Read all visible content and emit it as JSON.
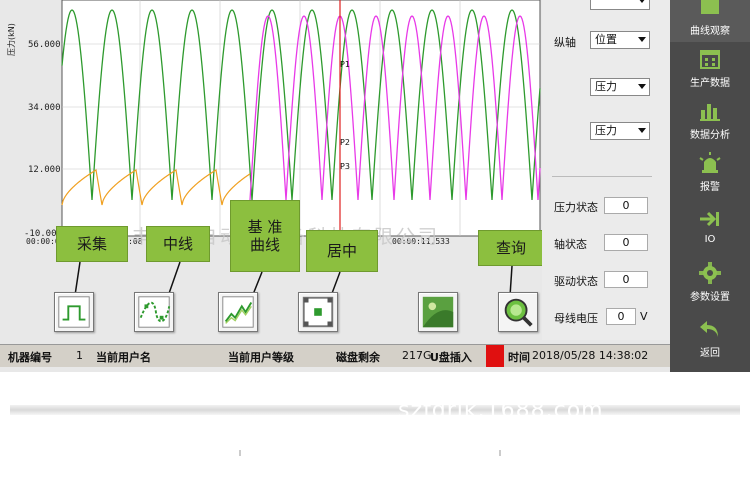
{
  "plot": {
    "y_ticks": [
      "56.000",
      "34.000",
      "12.000",
      "-10.00"
    ],
    "y_axis_label": "压力(kN)",
    "x_ticks": [
      "00:00:07",
      "00:00:08",
      "00:00:11.533"
    ],
    "markers": [
      "P1",
      "P2",
      "P3"
    ],
    "colors": {
      "green": "#2e9a2e",
      "magenta": "#e83ae8",
      "orange": "#f0a020",
      "cursor": "#e02020",
      "grid": "#c8c8c8"
    }
  },
  "watermark": "苏州丰达瑞自动化设备科技有限公司",
  "callouts": {
    "collect": "采集",
    "midline": "中线",
    "baseline": "基 准\n曲线",
    "center": "居中",
    "query": "查询"
  },
  "toolbar": {
    "icons": [
      "collect-icon",
      "midline-icon",
      "baseline-curve-icon",
      "center-icon",
      "image-icon",
      "query-icon"
    ]
  },
  "right_panel": {
    "y_axis_label": "纵轴",
    "y_axis_select": "位置",
    "select2": "压力",
    "select3": "压力",
    "pressure_status_label": "压力状态",
    "pressure_status_value": "0",
    "axis_status_label": "轴状态",
    "axis_status_value": "0",
    "drive_status_label": "驱动状态",
    "drive_status_value": "0",
    "bus_voltage_label": "母线电压",
    "bus_voltage_value": "0",
    "bus_voltage_unit": "V"
  },
  "nav": [
    {
      "label": "曲线观察",
      "icon": "curve-view-icon"
    },
    {
      "label": "生产数据",
      "icon": "calendar-icon"
    },
    {
      "label": "数据分析",
      "icon": "bar-chart-icon"
    },
    {
      "label": "报警",
      "icon": "alarm-icon"
    },
    {
      "label": "IO",
      "icon": "io-icon"
    },
    {
      "label": "参数设置",
      "icon": "gear-icon"
    },
    {
      "label": "返回",
      "icon": "back-arrow-icon"
    }
  ],
  "status_bar": {
    "machine_no_label": "机器编号",
    "machine_no_value": "1",
    "current_user_label": "当前用户名",
    "user_level_label": "当前用户等级",
    "disk_left_label": "磁盘剩余",
    "disk_left_value": "217G",
    "usb_label": "U盘插入",
    "usb_status_color": "#e01010",
    "time_label": "时间",
    "time_value": "2018/05/28  14:38:02"
  },
  "page_watermark": "szfdrjk.1688.com"
}
